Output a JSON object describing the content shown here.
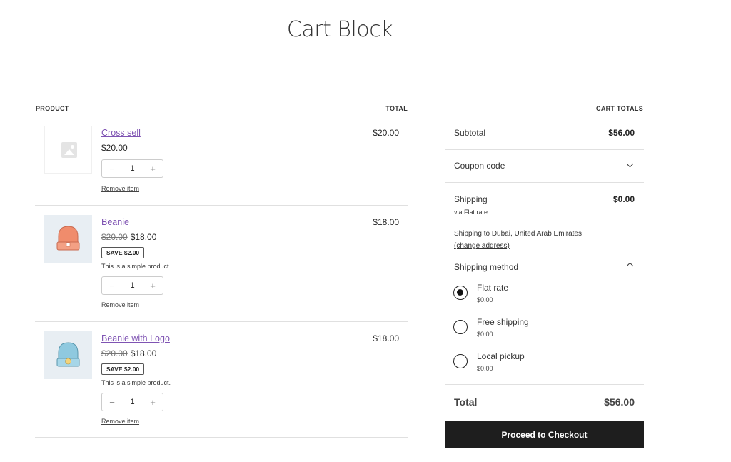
{
  "page": {
    "title": "Cart Block"
  },
  "table": {
    "product_header": "PRODUCT",
    "total_header": "TOTAL"
  },
  "items": [
    {
      "name": "Cross sell",
      "price": "$20.00",
      "quantity": "1",
      "remove_label": "Remove item",
      "line_total": "$20.00",
      "thumbnail": "placeholder-image-icon"
    },
    {
      "name": "Beanie",
      "old_price": "$20.00",
      "price": "$18.00",
      "save_badge": "SAVE $2.00",
      "description": "This is a simple product.",
      "quantity": "1",
      "remove_label": "Remove item",
      "line_total": "$18.00",
      "thumbnail": "orange-beanie-image",
      "color": "#f08c6c"
    },
    {
      "name": "Beanie with Logo",
      "old_price": "$20.00",
      "price": "$18.00",
      "save_badge": "SAVE $2.00",
      "description": "This is a simple product.",
      "quantity": "1",
      "remove_label": "Remove item",
      "line_total": "$18.00",
      "thumbnail": "blue-beanie-image",
      "color": "#8fc9df"
    }
  ],
  "totals": {
    "header": "CART TOTALS",
    "subtotal_label": "Subtotal",
    "subtotal_value": "$56.00",
    "coupon_label": "Coupon code",
    "shipping_label": "Shipping",
    "shipping_value": "$0.00",
    "shipping_via": "via Flat rate",
    "shipping_to": "Shipping to Dubai, United Arab Emirates",
    "change_address": "(change address)",
    "shipping_method_label": "Shipping method",
    "shipping_options": [
      {
        "label": "Flat rate",
        "price": "$0.00",
        "selected": true
      },
      {
        "label": "Free shipping",
        "price": "$0.00",
        "selected": false
      },
      {
        "label": "Local pickup",
        "price": "$0.00",
        "selected": false
      }
    ],
    "total_label": "Total",
    "total_value": "$56.00"
  },
  "checkout_button": "Proceed to Checkout",
  "colors": {
    "link": "#7f54b3",
    "button_bg": "#1e1e1e"
  },
  "icons": {
    "minus": "−",
    "plus": "+"
  }
}
